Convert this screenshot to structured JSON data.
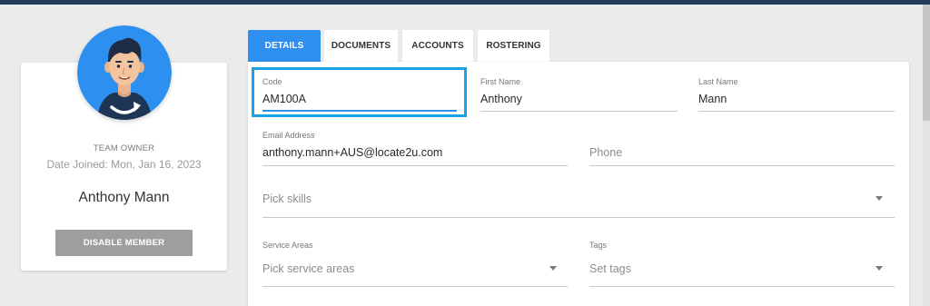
{
  "profile": {
    "role": "TEAM OWNER",
    "date_joined": "Date Joined: Mon, Jan 16, 2023",
    "full_name": "Anthony Mann",
    "disable_label": "DISABLE MEMBER",
    "avatar_bg": "#2d8ff0"
  },
  "tabs": [
    {
      "label": "DETAILS",
      "active": true
    },
    {
      "label": "DOCUMENTS",
      "active": false
    },
    {
      "label": "ACCOUNTS",
      "active": false
    },
    {
      "label": "ROSTERING",
      "active": false
    }
  ],
  "form": {
    "code": {
      "label": "Code",
      "value": "AM100A"
    },
    "first_name": {
      "label": "First Name",
      "value": "Anthony"
    },
    "last_name": {
      "label": "Last Name",
      "value": "Mann"
    },
    "email": {
      "label": "Email Address",
      "value": "anthony.mann+AUS@locate2u.com"
    },
    "phone": {
      "placeholder": "Phone"
    },
    "skills": {
      "placeholder": "Pick skills"
    },
    "service_areas": {
      "label": "Service Areas",
      "placeholder": "Pick service areas"
    },
    "tags": {
      "label": "Tags",
      "placeholder": "Set tags"
    }
  },
  "colors": {
    "accent": "#2d8ff0",
    "highlight": "#18a3e6",
    "header": "#243a5a"
  }
}
